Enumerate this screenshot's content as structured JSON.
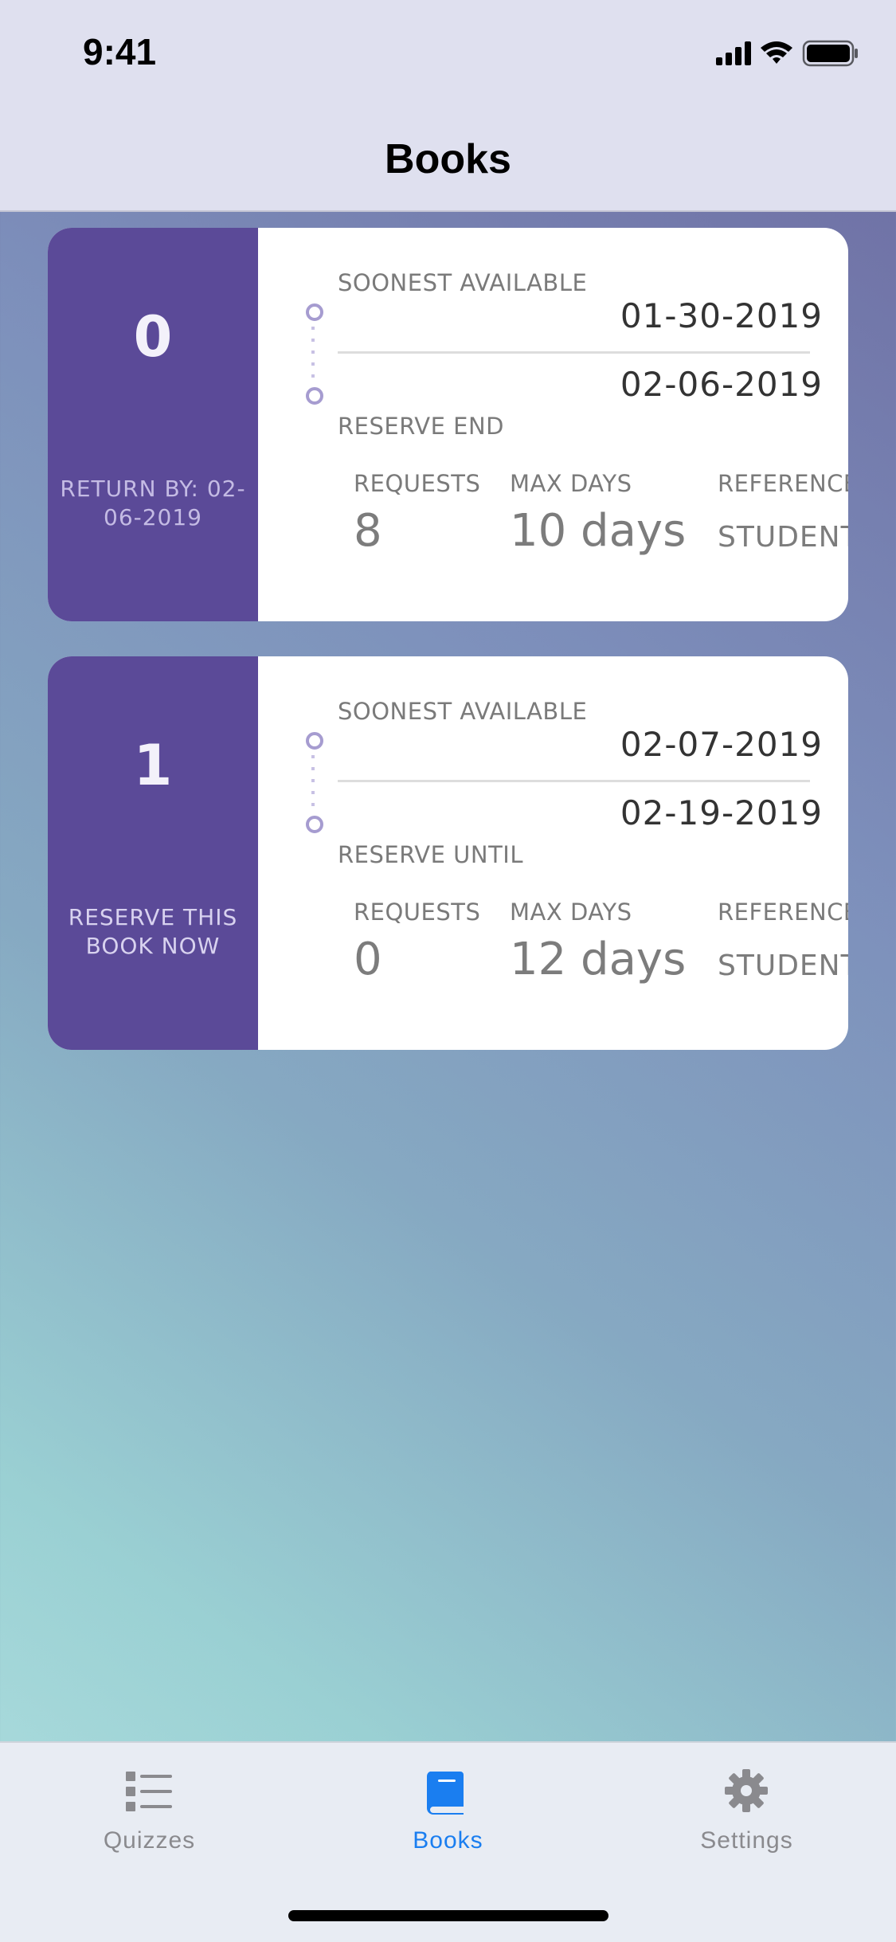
{
  "status_bar": {
    "time": "9:41",
    "icons": [
      "signal-icon",
      "wifi-icon",
      "battery-icon"
    ]
  },
  "nav": {
    "title": "Books"
  },
  "cards": [
    {
      "number": "0",
      "caption": "RETURN BY: 02-06-2019",
      "soonest_label": "SOONEST AVAILABLE",
      "soonest_date": "01-30-2019",
      "end_date": "02-06-2019",
      "end_label": "RESERVE END",
      "requests_label": "REQUESTS",
      "requests_value": "8",
      "max_days_label": "MAX DAYS",
      "max_days_value": "10 days",
      "reference_label": "REFERENCE",
      "reference_value": "STUDENT"
    },
    {
      "number": "1",
      "caption": "RESERVE THIS BOOK NOW",
      "soonest_label": "SOONEST AVAILABLE",
      "soonest_date": "02-07-2019",
      "end_date": "02-19-2019",
      "end_label": "RESERVE UNTIL",
      "requests_label": "REQUESTS",
      "requests_value": "0",
      "max_days_label": "MAX DAYS",
      "max_days_value": "12 days",
      "reference_label": "REFERENCE",
      "reference_value": "STUDENT"
    }
  ],
  "tabs": [
    {
      "label": "Quizzes",
      "icon": "checklist-icon",
      "active": false
    },
    {
      "label": "Books",
      "icon": "book-icon",
      "active": true
    },
    {
      "label": "Settings",
      "icon": "gear-icon",
      "active": false
    }
  ],
  "colors": {
    "card_accent": "#5b4a98",
    "tab_active": "#1a7ef0",
    "tab_inactive": "#8a8a8e"
  }
}
